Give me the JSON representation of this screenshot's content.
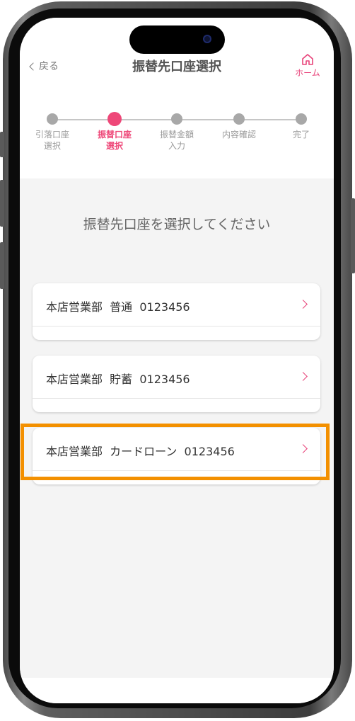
{
  "header": {
    "back_label": "戻る",
    "title": "振替先口座選択",
    "home_label": "ホーム"
  },
  "steps": [
    {
      "label": "引落口座\n選択",
      "active": false
    },
    {
      "label": "振替口座\n選択",
      "active": true
    },
    {
      "label": "振替金額\n入力",
      "active": false
    },
    {
      "label": "内容確認",
      "active": false
    },
    {
      "label": "完了",
      "active": false
    }
  ],
  "main": {
    "prompt": "振替先口座を選択してください",
    "accounts": [
      {
        "label": "本店営業部  普通  0123456"
      },
      {
        "label": "本店営業部  貯蓄  0123456"
      },
      {
        "label": "本店営業部  カードローン  0123456",
        "highlighted": true
      }
    ]
  },
  "colors": {
    "accent": "#ee4778",
    "highlight": "#f39000",
    "inactive_step": "#a8a8a8",
    "background": "#f4f4f4"
  },
  "icons": [
    "chevron-left-icon",
    "home-icon",
    "chevron-right-icon"
  ]
}
